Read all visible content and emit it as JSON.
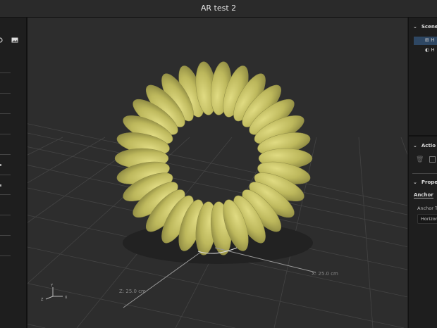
{
  "window": {
    "title": "AR test 2"
  },
  "viewport": {
    "x_dimension": "X:  25.0 cm",
    "z_dimension": "Z:  25.0 cm",
    "axis_gizmo": {
      "y": "Y",
      "x": "X",
      "z": "Z"
    },
    "model_color": "#c9c465"
  },
  "right_panel": {
    "scene": {
      "title": "Scene",
      "items": [
        {
          "label": "H",
          "icon": "anchor-icon",
          "selected": true
        },
        {
          "label": "H",
          "icon": "light-icon",
          "selected": false
        }
      ]
    },
    "actions": {
      "title": "Actio",
      "icons": [
        "trash-icon",
        "duplicate-icon"
      ]
    },
    "properties": {
      "title": "Prope",
      "tab": "Anchor",
      "field_label": "Anchor Ty",
      "field_value": "Horizont"
    }
  }
}
